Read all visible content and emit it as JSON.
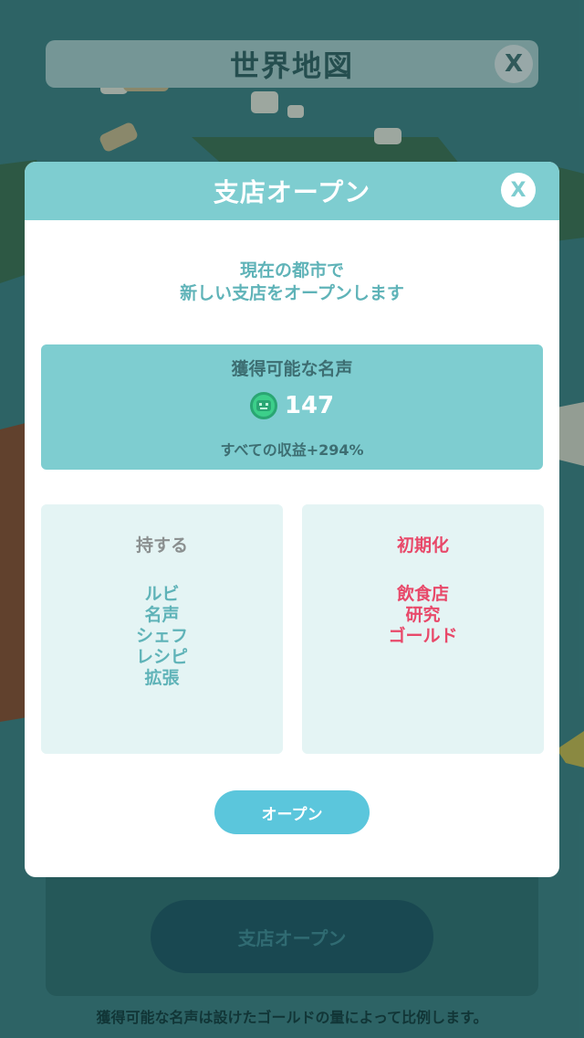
{
  "background": {
    "title": "世界地図",
    "close_label": "X",
    "open_branch_button": "支店オープン",
    "note": "獲得可能な名声は設けたゴールドの量によって比例します。"
  },
  "modal": {
    "title": "支店オープン",
    "close_label": "X",
    "description_line1": "現在の都市で",
    "description_line2": "新しい支店をオープンします",
    "fame": {
      "label": "獲得可能な名声",
      "icon": "fame-coin-icon",
      "value": "147",
      "bonus": "すべての収益+294%"
    },
    "keep": {
      "title": "持する",
      "items": [
        "ルビ",
        "名声",
        "シェフ",
        "レシピ",
        "拡張"
      ]
    },
    "reset": {
      "title": "初期化",
      "items": [
        "飲食店",
        "研究",
        "ゴールド"
      ]
    },
    "open_button": "オープン"
  },
  "colors": {
    "header_teal": "#7ecdd0",
    "text_teal": "#5fb3b8",
    "reset_red": "#e8496a",
    "button_blue": "#5bc6dc"
  }
}
